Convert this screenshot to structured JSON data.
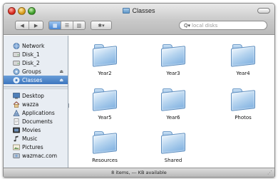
{
  "window": {
    "title": "Classes"
  },
  "toolbar": {
    "back_glyph": "◀",
    "forward_glyph": "▶",
    "view_icon_glyph": "▦",
    "view_list_glyph": "☰",
    "view_column_glyph": "▥",
    "action_glyph": "✱▾",
    "search_placeholder": "local disks",
    "search_glyph": "Q▾"
  },
  "sidebar": {
    "devices": [
      {
        "label": "Network",
        "icon": "network-globe-icon"
      },
      {
        "label": "Disk_1",
        "icon": "disk-icon"
      },
      {
        "label": "Disk_2",
        "icon": "disk-icon"
      },
      {
        "label": "Groups",
        "icon": "server-volume-icon",
        "eject": "⏏"
      },
      {
        "label": "Classes",
        "icon": "server-volume-icon",
        "eject": "⏏",
        "selected": true
      }
    ],
    "places": [
      {
        "label": "Desktop",
        "icon": "desktop-icon"
      },
      {
        "label": "wazza",
        "icon": "home-icon"
      },
      {
        "label": "Applications",
        "icon": "applications-icon"
      },
      {
        "label": "Documents",
        "icon": "documents-icon"
      },
      {
        "label": "Movies",
        "icon": "movies-icon"
      },
      {
        "label": "Music",
        "icon": "music-icon"
      },
      {
        "label": "Pictures",
        "icon": "pictures-icon"
      },
      {
        "label": "wazmac.com",
        "icon": "idisk-icon"
      }
    ]
  },
  "folders": [
    {
      "label": "Year2"
    },
    {
      "label": "Year3"
    },
    {
      "label": "Year4"
    },
    {
      "label": "Year5"
    },
    {
      "label": "Year6"
    },
    {
      "label": "Photos"
    },
    {
      "label": "Resources"
    },
    {
      "label": "Shared"
    }
  ],
  "status": {
    "text": "8 items, --- KB available"
  },
  "colors": {
    "selection": "#3d76bf",
    "folder_blue": "#7fb0e0",
    "sidebar_bg": "#e8edf3"
  }
}
